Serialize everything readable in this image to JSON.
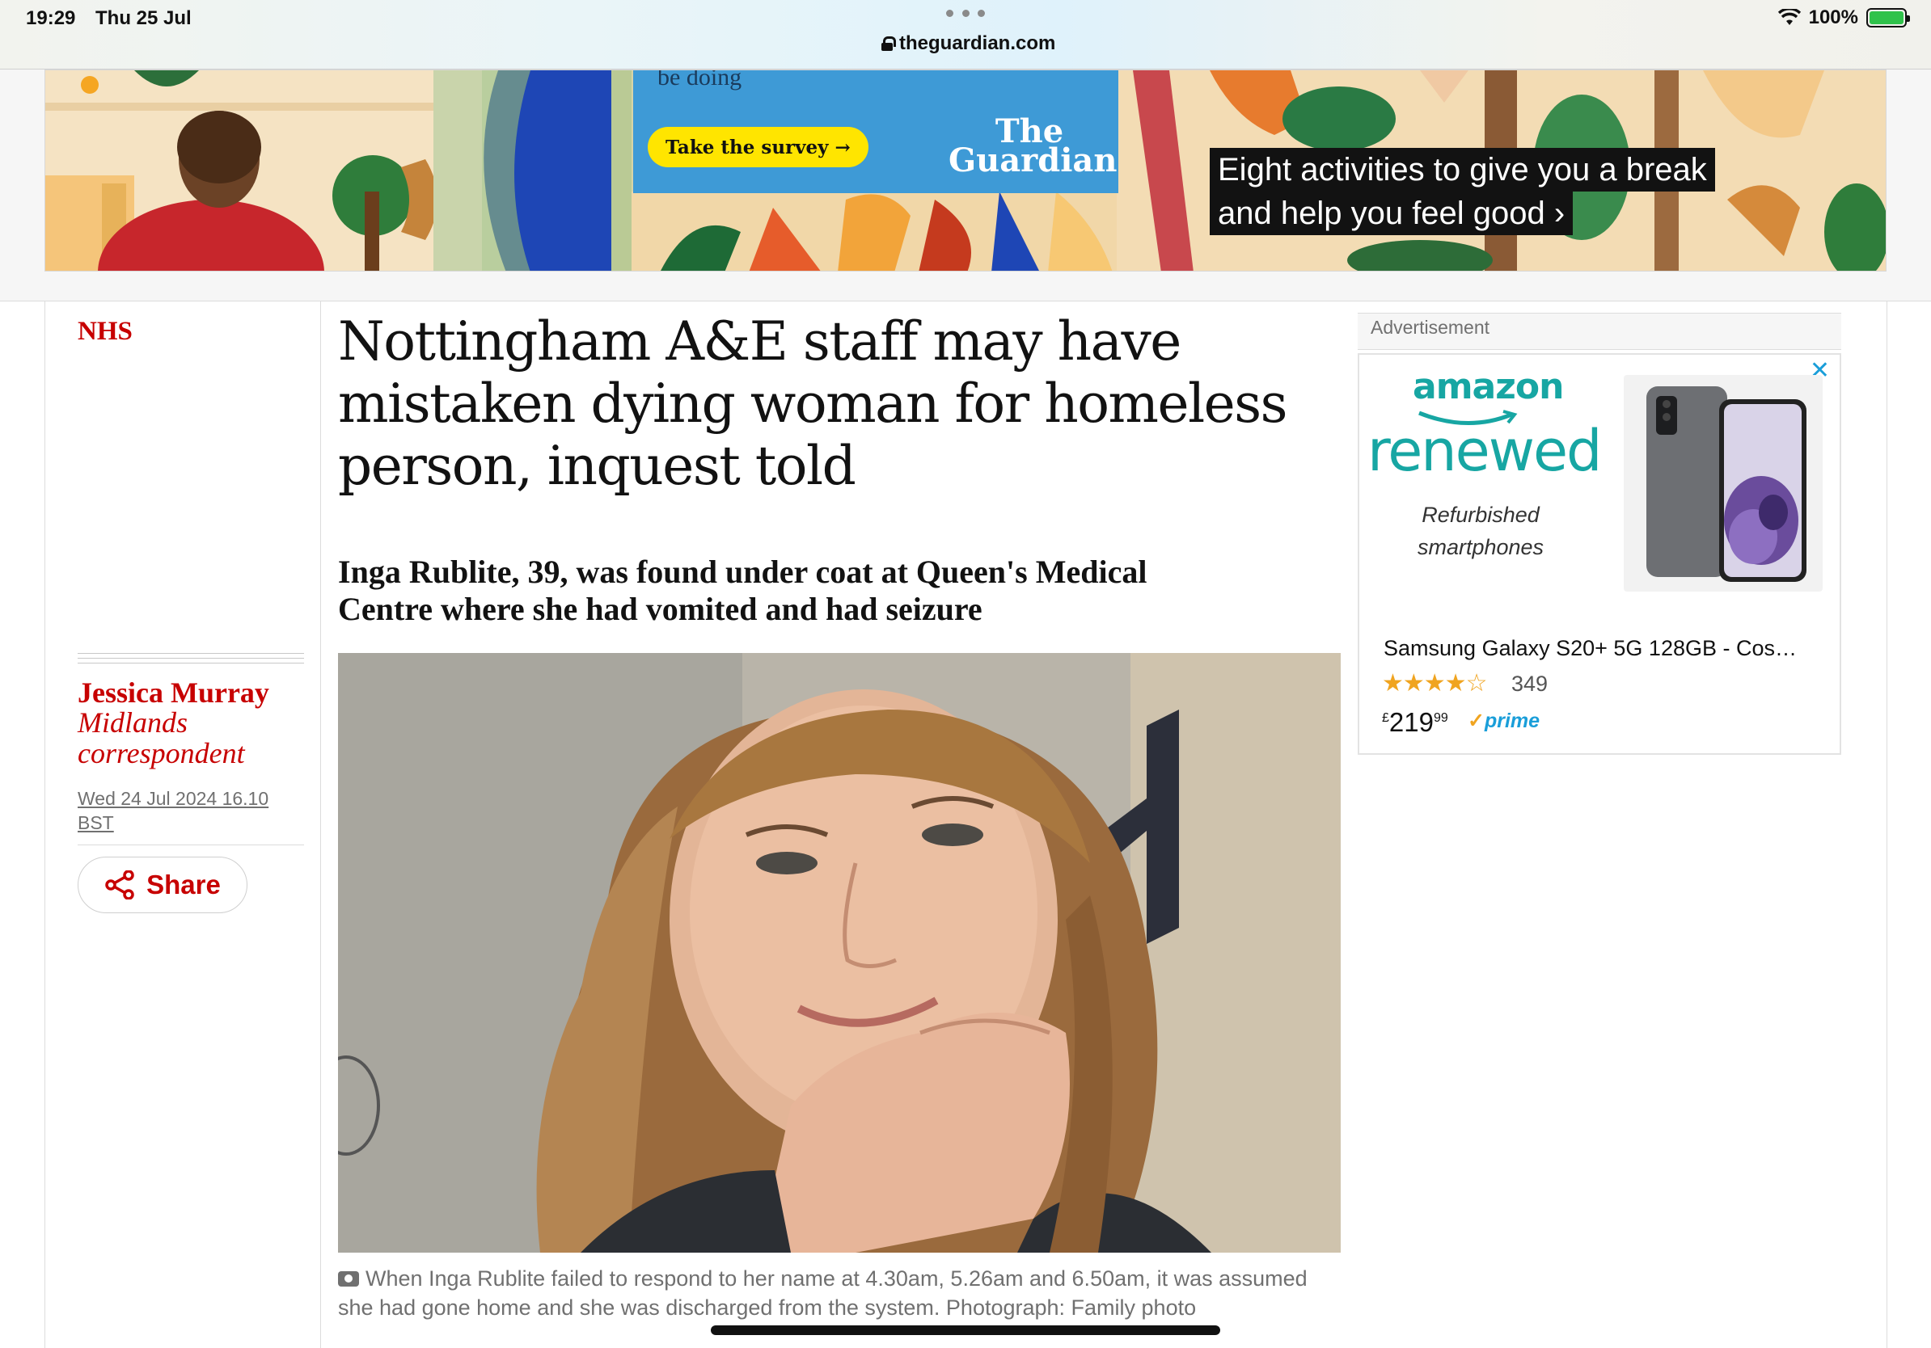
{
  "status_bar": {
    "time": "19:29",
    "date": "Thu 25 Jul",
    "url": "theguardian.com",
    "battery": "100%"
  },
  "top_banner": {
    "poster_text": "be doing",
    "survey_button": "Take the survey →",
    "logo_line1": "The",
    "logo_line2": "Guardian",
    "headline_line1": "Eight activities to give you a break",
    "headline_line2": "and help you feel good ›"
  },
  "article": {
    "section": "NHS",
    "headline": "Nottingham A&E staff may have mistaken dying woman for homeless person, inquest told",
    "standfirst": "Inga Rublite, 39, was found under coat at Queen's Medical Centre where she had vomited and had seizure",
    "author": "Jessica Murray",
    "author_role": "Midlands correspondent",
    "dateline": "Wed 24 Jul 2024 16.10 BST",
    "share_label": "Share",
    "caption": "When Inga Rublite failed to respond to her name at 4.30am, 5.26am and 6.50am, it was assumed she had gone home and she was discharged from the system. Photograph: Family photo"
  },
  "advert": {
    "label": "Advertisement",
    "close": "✕",
    "brand": "amazon",
    "renewed": "renewed",
    "tagline": "Refurbished smartphones",
    "product_title": "Samsung Galaxy S20+ 5G 128GB - Cos…",
    "stars": "★★★★☆",
    "rating_count": "349",
    "price_currency": "£",
    "price_main": "219",
    "price_pence": "99",
    "prime": "prime"
  },
  "colors": {
    "guardian_red": "#c70000",
    "amazon_teal": "#17a6a3",
    "survey_yellow": "#ffe500",
    "poster_blue": "#3e9ad6"
  }
}
